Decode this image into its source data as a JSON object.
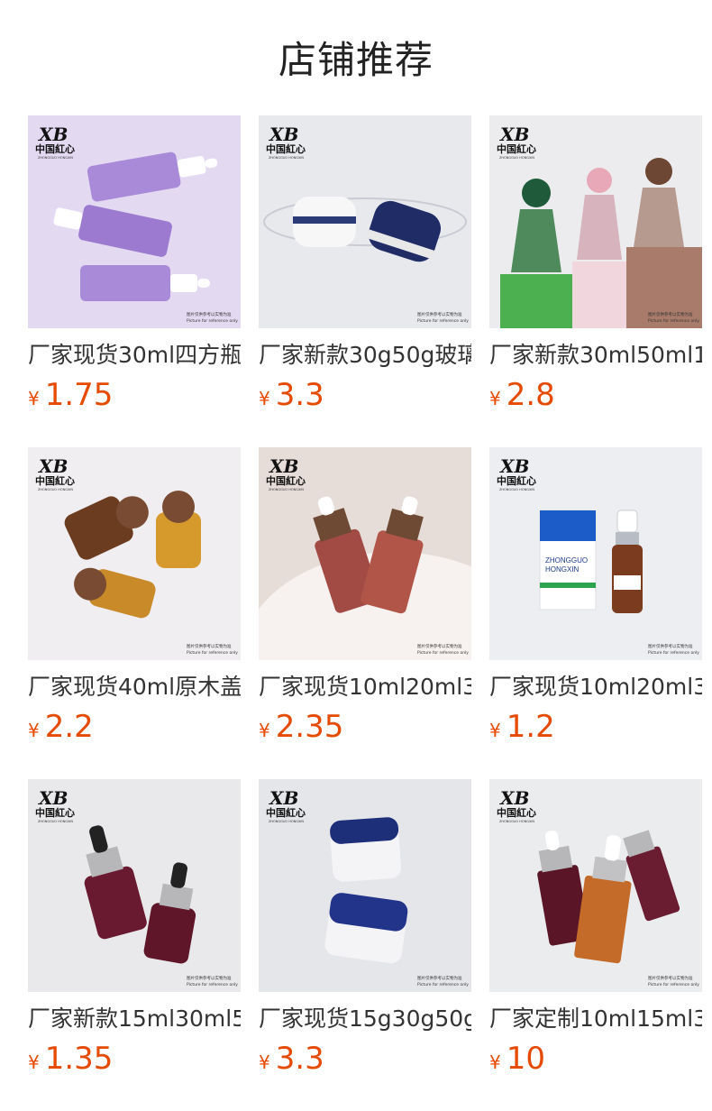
{
  "page_title": "店铺推荐",
  "brand": {
    "logo_mark": "XB",
    "logo_cn": "中国紅心",
    "logo_en": "ZHONGGUO HONGXIN"
  },
  "watermark": [
    "图片仅供参考以实物为准",
    "Picture for reference only"
  ],
  "products": [
    {
      "name": "厂家现货30ml四方瓶",
      "currency": "¥",
      "price": "1.75",
      "image_icon": "purple-dropper-bottles-image",
      "bg": "#e3daf2"
    },
    {
      "name": "厂家新款30g50g玻璃",
      "currency": "¥",
      "price": "3.3",
      "image_icon": "white-navy-cream-jars-image",
      "bg": "#e8e9ec"
    },
    {
      "name": "厂家新款30ml50ml1",
      "currency": "¥",
      "price": "2.8",
      "image_icon": "gradient-ball-cap-bottles-image",
      "bg": "#ececee"
    },
    {
      "name": "厂家现货40ml原木盖",
      "currency": "¥",
      "price": "2.2",
      "image_icon": "amber-wood-cap-bottles-image",
      "bg": "#f0eef0"
    },
    {
      "name": "厂家现货10ml20ml3",
      "currency": "¥",
      "price": "2.35",
      "image_icon": "rose-wood-dropper-bottles-image",
      "bg": "#e6dcd8"
    },
    {
      "name": "厂家现货10ml20ml3",
      "currency": "¥",
      "price": "1.2",
      "image_icon": "box-and-pump-bottle-image",
      "bg": "#eceef2"
    },
    {
      "name": "厂家新款15ml30ml5",
      "currency": "¥",
      "price": "1.35",
      "image_icon": "burgundy-dropper-bottles-image",
      "bg": "#e9e9ec"
    },
    {
      "name": "厂家现货15g30g50g",
      "currency": "¥",
      "price": "3.3",
      "image_icon": "blue-lid-cream-jars-image",
      "bg": "#e4e6ea"
    },
    {
      "name": "厂家定制10ml15ml3",
      "currency": "¥",
      "price": "10",
      "image_icon": "burgundy-amber-droppers-image",
      "bg": "#ebecee"
    }
  ]
}
